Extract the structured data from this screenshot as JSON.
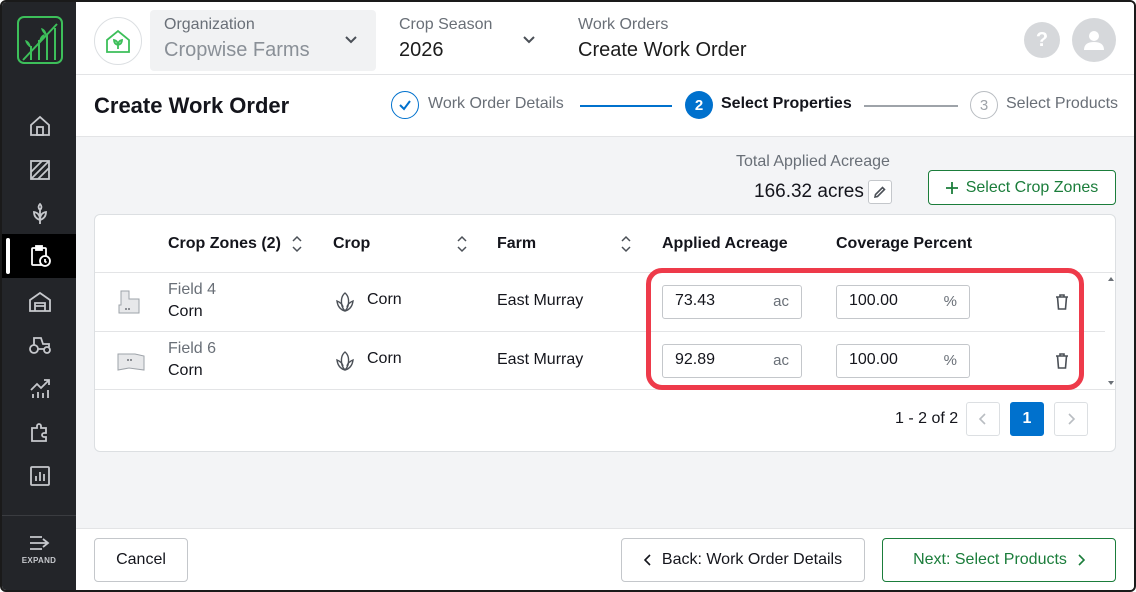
{
  "header": {
    "organization": {
      "label": "Organization",
      "value": "Cropwise Farms"
    },
    "crop_season": {
      "label": "Crop Season",
      "value": "2026"
    },
    "work_orders": {
      "label": "Work Orders",
      "value": "Create Work Order"
    },
    "help_glyph": "?"
  },
  "page": {
    "title": "Create Work Order",
    "steps": [
      {
        "number": "1",
        "label": "Work Order Details",
        "status": "complete"
      },
      {
        "number": "2",
        "label": "Select Properties",
        "status": "active"
      },
      {
        "number": "3",
        "label": "Select Products",
        "status": "upcoming"
      }
    ]
  },
  "summary": {
    "label": "Total Applied Acreage",
    "value": "166.32 acres",
    "select_button": "Select Crop Zones"
  },
  "table": {
    "headers": [
      "Crop Zones (2)",
      "Crop",
      "Farm",
      "Applied Acreage",
      "Coverage Percent"
    ],
    "rows": [
      {
        "field": "Field 4",
        "zone_crop": "Corn",
        "crop": "Corn",
        "farm": "East Murray",
        "acreage": "73.43",
        "acreage_unit": "ac",
        "coverage": "100.00",
        "coverage_unit": "%"
      },
      {
        "field": "Field 6",
        "zone_crop": "Corn",
        "crop": "Corn",
        "farm": "East Murray",
        "acreage": "92.89",
        "acreage_unit": "ac",
        "coverage": "100.00",
        "coverage_unit": "%"
      }
    ],
    "pagination": {
      "range": "1 - 2 of 2",
      "current_page": "1"
    }
  },
  "footer": {
    "cancel": "Cancel",
    "back": "Back: Work Order Details",
    "next": "Next: Select Products"
  },
  "sidebar": {
    "items": [
      "home-icon",
      "fields-icon",
      "crop-icon",
      "work-orders-icon",
      "storage-icon",
      "equipment-icon",
      "analytics-icon",
      "integrations-icon",
      "reports-icon"
    ],
    "expand_label": "EXPAND"
  },
  "colors": {
    "brand_green": "#1b7d3b",
    "step_blue": "#0071cd",
    "sidebar_bg": "#232529",
    "highlight_red": "#ee3a4a"
  }
}
